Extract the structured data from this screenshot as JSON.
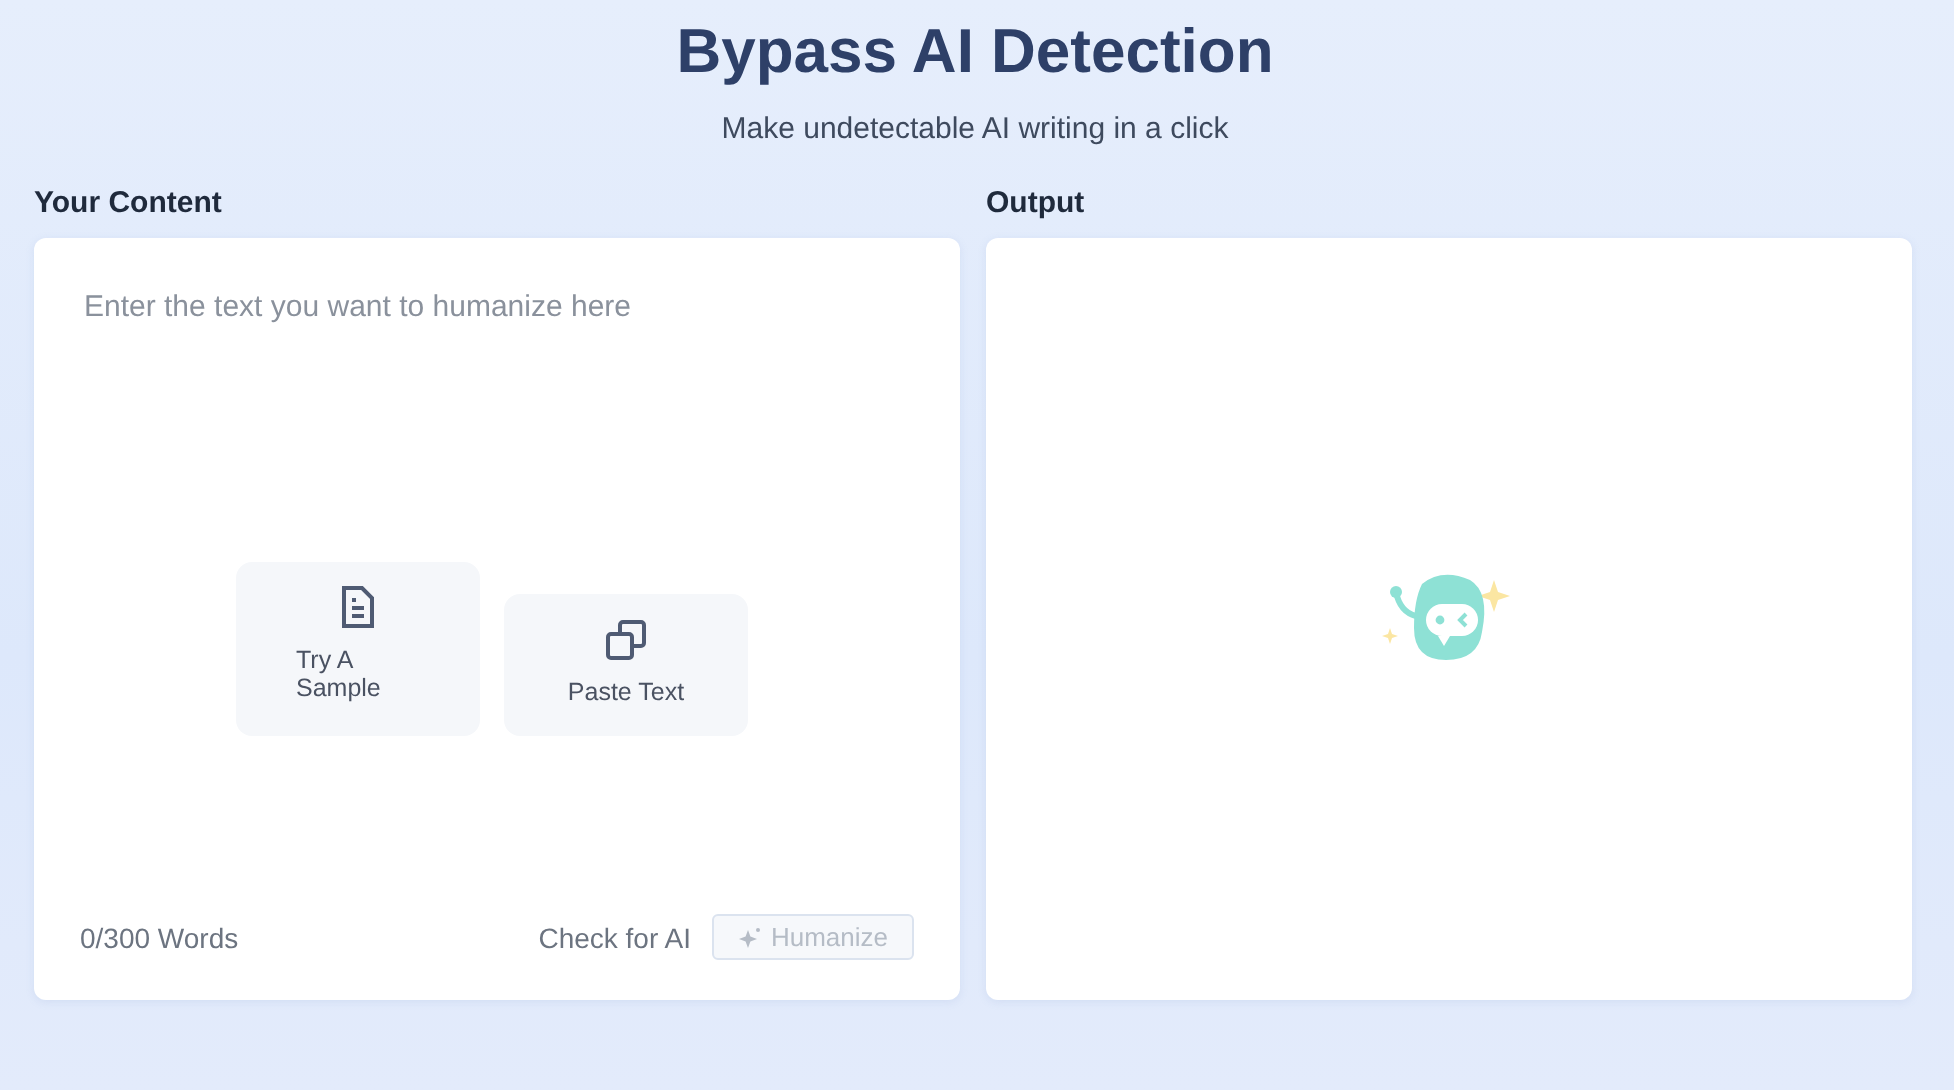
{
  "header": {
    "title": "Bypass AI Detection",
    "subtitle": "Make undetectable AI writing in a click"
  },
  "input_panel": {
    "label": "Your Content",
    "placeholder": "Enter the text you want to humanize here",
    "actions": [
      {
        "kind": "sample",
        "label": "Try A Sample"
      },
      {
        "kind": "paste",
        "label": "Paste Text"
      }
    ],
    "word_count": "0/300 Words",
    "check_link": "Check for AI",
    "humanize_button": {
      "label": "Humanize",
      "disabled": true
    }
  },
  "output_panel": {
    "label": "Output"
  }
}
